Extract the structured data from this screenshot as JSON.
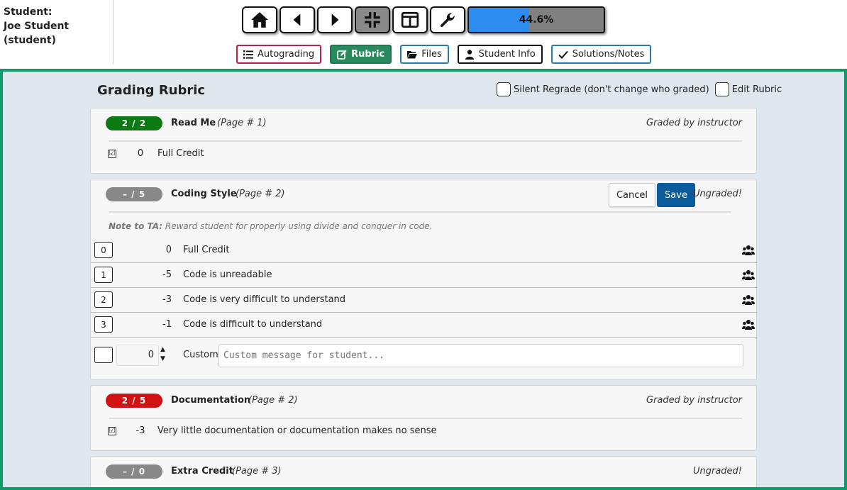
{
  "student": {
    "label": "Student:",
    "name": "Joe Student (student)"
  },
  "toolbar": {
    "buttons": [
      {
        "icon": "home-icon"
      },
      {
        "icon": "prev-arrow-icon"
      },
      {
        "icon": "next-arrow-icon"
      },
      {
        "icon": "collapse-icon"
      },
      {
        "icon": "two-panel-layout-icon"
      },
      {
        "icon": "wrench-icon"
      }
    ],
    "progress_text": "44.6%",
    "progress_value": 44.6
  },
  "nav_tabs": {
    "autograding": "Autograding",
    "rubric": "Rubric",
    "files": "Files",
    "student_info": "Student Info",
    "solutions": "Solutions/Notes"
  },
  "rubric": {
    "title": "Grading Rubric",
    "silent_regrade": "Silent Regrade (don't change who graded)",
    "edit_rubric": "Edit Rubric",
    "components": [
      {
        "score": "2 / 2",
        "name": "Read Me",
        "page": "(Page # 1)",
        "status": "Graded by instructor",
        "selected_mark": {
          "check": "☑",
          "points": "0",
          "text": "Full Credit"
        }
      },
      {
        "score": "– / 5",
        "name": "Coding Style",
        "page": "(Page # 2)",
        "status": "Ungraded!",
        "cancel_label": "Cancel",
        "save_label": "Save",
        "note_label": "Note to TA:",
        "note_text": "Reward student for properly using divide and conquer in code.",
        "marks": [
          {
            "key": "0",
            "points": "0",
            "text": "Full Credit"
          },
          {
            "key": "1",
            "points": "-5",
            "text": "Code is unreadable"
          },
          {
            "key": "2",
            "points": "-3",
            "text": "Code is very difficult to understand"
          },
          {
            "key": "3",
            "points": "-1",
            "text": "Code is difficult to understand"
          }
        ],
        "custom": {
          "points": "0",
          "label": "Custom:",
          "placeholder": "Custom message for student..."
        }
      },
      {
        "score": "2 / 5",
        "name": "Documentation",
        "page": "(Page # 2)",
        "status": "Graded by instructor",
        "selected_mark": {
          "check": "☑",
          "points": "-3",
          "text": "Very little documentation or documentation makes no sense"
        }
      },
      {
        "score": "– / 0",
        "name": "Extra Credit",
        "page": "(Page # 3)",
        "status": "Ungraded!"
      }
    ]
  },
  "colors": {
    "frame_border": "#0f9a6a",
    "progress_fill": "#2d8cf0",
    "save_button": "#0a5d9a",
    "badge_full": "#0b7a14",
    "badge_partial": "#d01212",
    "badge_ungraded": "#888888"
  }
}
